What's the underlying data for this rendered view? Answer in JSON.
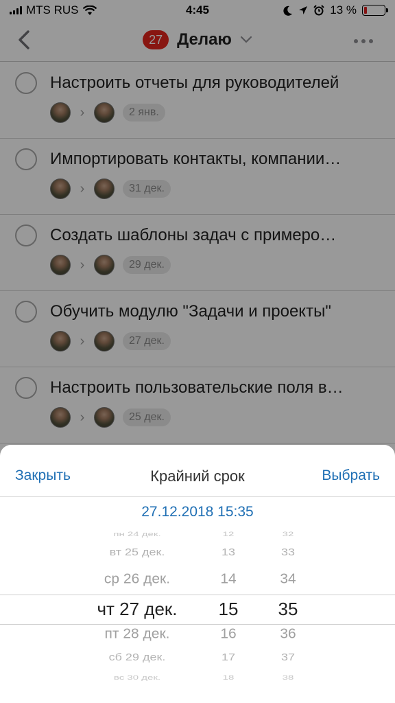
{
  "status_bar": {
    "carrier": "MTS RUS",
    "time": "4:45",
    "battery_percent": "13 %",
    "battery_level": 0.13
  },
  "nav": {
    "count": "27",
    "title": "Делаю"
  },
  "tasks": [
    {
      "title": "Настроить отчеты для руководителей",
      "date": "2 янв."
    },
    {
      "title": "Импортировать контакты, компании…",
      "date": "31 дек."
    },
    {
      "title": "Создать шаблоны задач с примеро…",
      "date": "29 дек."
    },
    {
      "title": "Обучить модулю \"Задачи и проекты\"",
      "date": "27 дек."
    },
    {
      "title": "Настроить пользовательские поля в…",
      "date": "25 дек."
    }
  ],
  "sheet": {
    "close_label": "Закрыть",
    "title": "Крайний срок",
    "select_label": "Выбрать",
    "selected_value": "27.12.2018 15:35"
  },
  "picker": {
    "dates": [
      "пн 24 дек.",
      "вт 25 дек.",
      "ср 26 дек.",
      "чт 27 дек.",
      "пт 28 дек.",
      "сб 29 дек.",
      "вс 30 дек."
    ],
    "hours": [
      "12",
      "13",
      "14",
      "15",
      "16",
      "17",
      "18"
    ],
    "minutes": [
      "32",
      "33",
      "34",
      "35",
      "36",
      "37",
      "38"
    ],
    "selected_index": 3
  },
  "colors": {
    "accent": "#1f6fb4",
    "badge": "#e3251d",
    "battery_low": "#e02020"
  }
}
